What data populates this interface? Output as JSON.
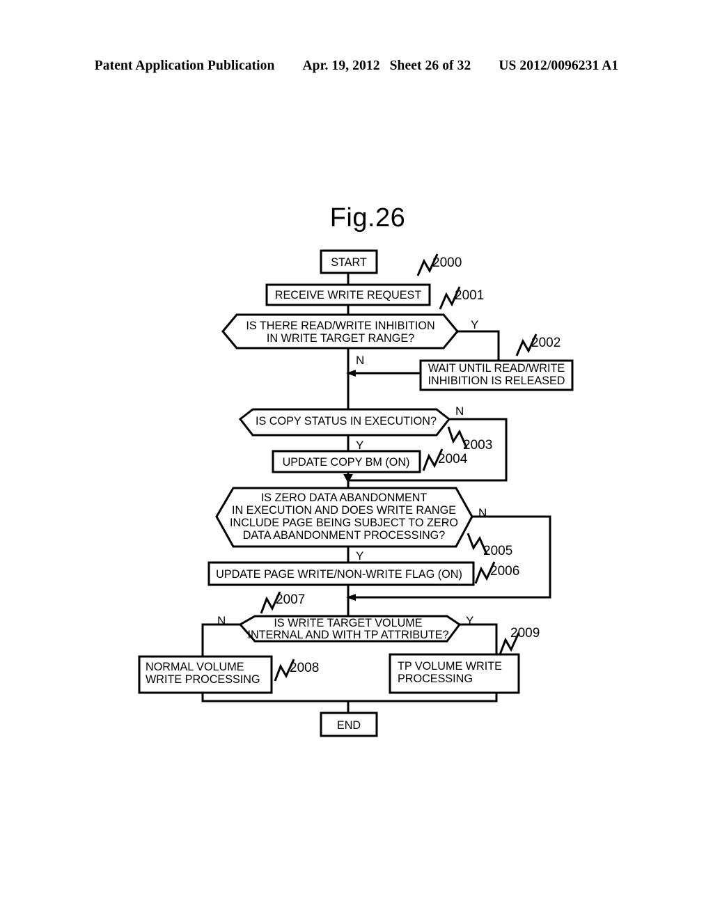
{
  "header": {
    "publication": "Patent Application Publication",
    "date": "Apr. 19, 2012",
    "sheet": "Sheet 26 of 32",
    "pub_number": "US 2012/0096231 A1"
  },
  "figure": {
    "title": "Fig.26"
  },
  "flowchart": {
    "nodes": {
      "start": {
        "label": "START",
        "ref": "2000"
      },
      "receive_write_request": {
        "label": "RECEIVE WRITE REQUEST",
        "ref": "2001"
      },
      "decision_rw_inhibition": {
        "line1": "IS THERE READ/WRITE INHIBITION",
        "line2": "IN WRITE TARGET RANGE?",
        "yes": "Y",
        "no": "N"
      },
      "wait_rw_inhibition": {
        "line1": "WAIT UNTIL READ/WRITE",
        "line2": "INHIBITION IS RELEASED",
        "ref": "2002"
      },
      "decision_copy_status": {
        "line1": "IS COPY STATUS IN EXECUTION?",
        "yes": "Y",
        "no": "N",
        "ref": "2003"
      },
      "update_copy_bm": {
        "label": "UPDATE COPY BM (ON)",
        "ref": "2004"
      },
      "decision_zero_data": {
        "line1": "IS ZERO DATA ABANDONMENT",
        "line2": "IN EXECUTION AND DOES WRITE RANGE",
        "line3": "INCLUDE PAGE BEING SUBJECT TO ZERO",
        "line4": "DATA ABANDONMENT PROCESSING?",
        "yes": "Y",
        "no": "N",
        "ref": "2005"
      },
      "update_page_flag": {
        "label": "UPDATE PAGE WRITE/NON-WRITE FLAG (ON)",
        "ref": "2006"
      },
      "decision_tp_attribute": {
        "line1": "IS WRITE TARGET VOLUME",
        "line2": "INTERNAL AND WITH TP ATTRIBUTE?",
        "yes": "Y",
        "no": "N",
        "ref": "2007"
      },
      "normal_volume_write": {
        "line1": "NORMAL VOLUME",
        "line2": "WRITE PROCESSING",
        "ref": "2008"
      },
      "tp_volume_write": {
        "line1": "TP VOLUME WRITE",
        "line2": "PROCESSING",
        "ref": "2009"
      },
      "end": {
        "label": "END"
      }
    }
  },
  "colors": {
    "ink": "#000000",
    "paper": "#ffffff"
  }
}
